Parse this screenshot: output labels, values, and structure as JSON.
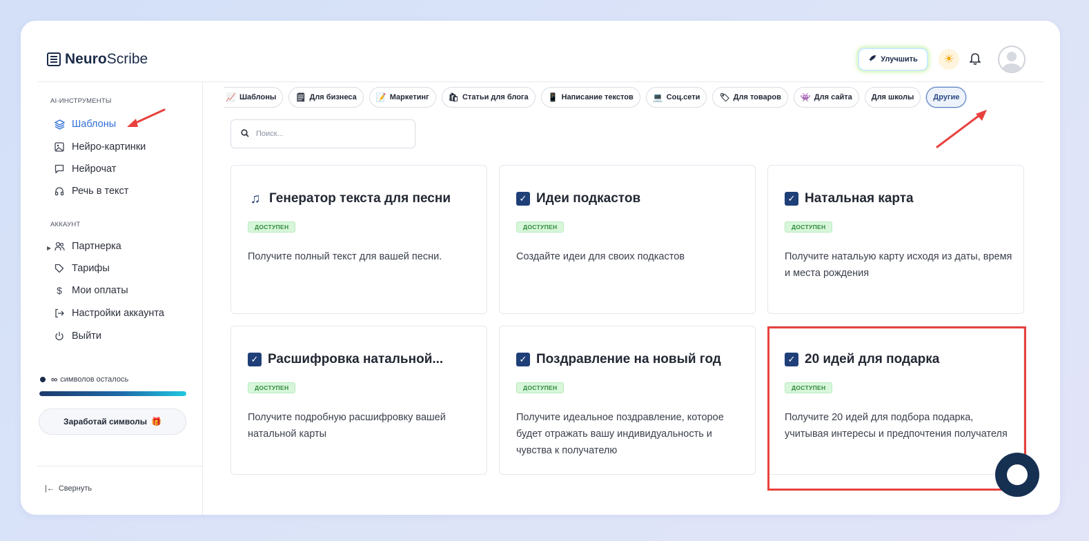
{
  "header": {
    "logo_bold": "Neuro",
    "logo_light": "Scribe",
    "upgrade_label": "Улучшить"
  },
  "sidebar": {
    "section_ai": "AI-ИНСТРУМЕНТЫ",
    "ai_items": [
      {
        "label": "Шаблоны",
        "icon": "layers-icon",
        "active": true
      },
      {
        "label": "Нейро-картинки",
        "icon": "image-icon"
      },
      {
        "label": "Нейрочат",
        "icon": "chat-icon"
      },
      {
        "label": "Речь в текст",
        "icon": "headphones-icon"
      }
    ],
    "section_account": "АККАУНТ",
    "account_items": [
      {
        "label": "Партнерка",
        "icon": "users-icon"
      },
      {
        "label": "Тарифы",
        "icon": "tag-icon"
      },
      {
        "label": "Мои оплаты",
        "icon": "dollar-icon"
      },
      {
        "label": "Настройки аккаунта",
        "icon": "logout-arrow-icon"
      },
      {
        "label": "Выйти",
        "icon": "power-icon"
      }
    ],
    "symbols_infinity": "∞",
    "symbols_text": "символов осталось",
    "symbols_progress": 1.0,
    "earn_label": "Заработай символы",
    "collapse_label": "Свернуть"
  },
  "tabs": [
    {
      "label": "Шаблоны",
      "emoji": "📈"
    },
    {
      "label": "Для бизнеса",
      "emoji": "🗒"
    },
    {
      "label": "Маркетинг",
      "emoji": "📝"
    },
    {
      "label": "Статьи для блога",
      "emoji": "🛍"
    },
    {
      "label": "Написание текстов",
      "emoji": "📱"
    },
    {
      "label": "Соц.сети",
      "emoji": "💻"
    },
    {
      "label": "Для товаров",
      "emoji": "🏷"
    },
    {
      "label": "Для сайта",
      "emoji": "👾"
    },
    {
      "label": "Для школы",
      "emoji": ""
    },
    {
      "label": "Другие",
      "emoji": "",
      "active": true
    }
  ],
  "search": {
    "placeholder": "Поиск..."
  },
  "badge_label": "ДОСТУПЕН",
  "cards": [
    {
      "title": "Генератор текста для песни",
      "icon": "music-note-icon",
      "desc": "Получите полный текст для вашей песни."
    },
    {
      "title": "Идеи подкастов",
      "icon": "checkbox-icon",
      "desc": "Создайте идеи для своих подкастов"
    },
    {
      "title": "Натальная карта",
      "icon": "checkbox-icon",
      "desc": "Получите натальую карту исходя из даты, время и места рождения"
    },
    {
      "title": "Расшифровка натальной...",
      "icon": "checkbox-icon",
      "desc": "Получите подробную расшифровку вашей натальной карты"
    },
    {
      "title": "Поздравление на новый год",
      "icon": "checkbox-icon",
      "desc": "Получите идеальное поздравление, которое будет отражать вашу индивидуальность и чувства к получателю"
    },
    {
      "title": "20 идей для подарка",
      "icon": "checkbox-icon",
      "desc": "Получите 20 идей для подбора подарка, учитывая интересы и предпочтения получателя"
    }
  ],
  "colors": {
    "accent": "#2f6fd6",
    "badge_bg": "#d7f6da",
    "annotation_red": "#e8413d",
    "chat_bubble": "#163052"
  }
}
